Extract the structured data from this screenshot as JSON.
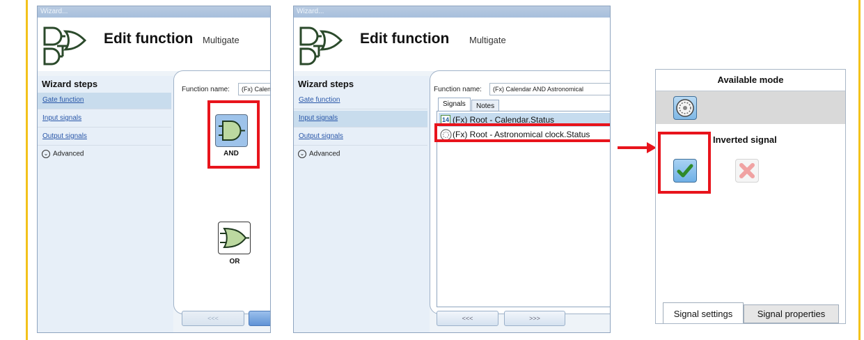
{
  "window1": {
    "title": "Wizard...",
    "header_title": "Edit function",
    "header_subtitle": "Multigate",
    "wizard_steps_title": "Wizard steps",
    "steps": [
      "Gate function",
      "Input signals",
      "Output signals"
    ],
    "advanced": "Advanced",
    "function_name_label": "Function name:",
    "function_name_value": "(Fx) Calendar AND Astronomical",
    "gates": [
      {
        "label": "AND"
      },
      {
        "label": "OR"
      }
    ],
    "nav_prev": "<<<",
    "nav_next": ">>>"
  },
  "window2": {
    "title": "Wizard...",
    "header_title": "Edit function",
    "header_subtitle": "Multigate",
    "wizard_steps_title": "Wizard steps",
    "steps": [
      "Gate function",
      "Input signals",
      "Output signals"
    ],
    "advanced": "Advanced",
    "function_name_label": "Function name:",
    "function_name_value": "(Fx) Calendar AND Astronomical",
    "tabs": [
      "Signals",
      "Notes"
    ],
    "signals": [
      {
        "icon": "calendar-icon",
        "icon_text": "14",
        "label": "(Fx) Root - Calendar.Status"
      },
      {
        "icon": "astronomical-clock-icon",
        "label": "(Fx) Root - Astronomical clock.Status"
      }
    ],
    "nav_prev": "<<<",
    "nav_next": ">>>"
  },
  "panel": {
    "available_mode": "Available mode",
    "inverted_signal": "Inverted signal",
    "tabs": [
      "Signal settings",
      "Signal properties"
    ]
  },
  "colors": {
    "highlight_red": "#e8141c",
    "accent_gold": "#f3c21b",
    "selection_blue": "#c6dcef",
    "link_blue": "#2856a8"
  }
}
